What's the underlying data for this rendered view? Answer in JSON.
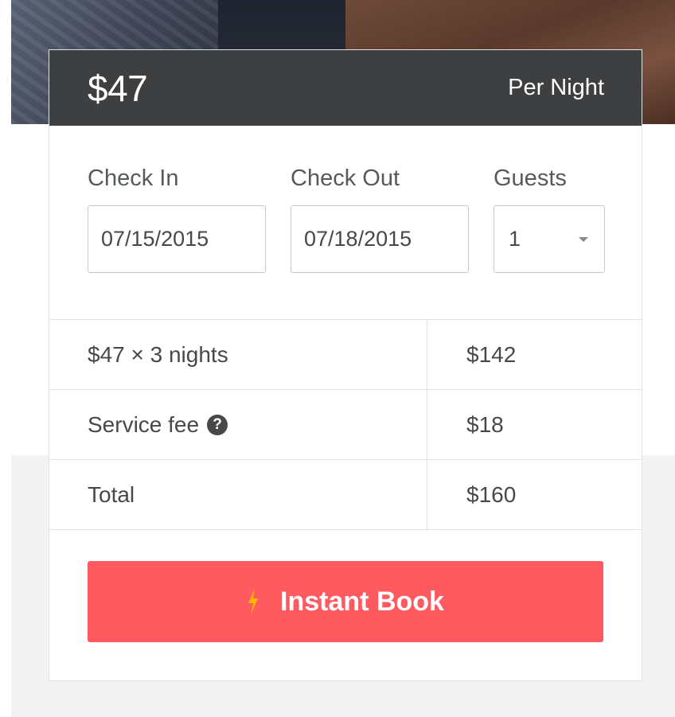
{
  "header": {
    "price": "$47",
    "per_night": "Per Night"
  },
  "booking": {
    "check_in": {
      "label": "Check In",
      "value": "07/15/2015"
    },
    "check_out": {
      "label": "Check Out",
      "value": "07/18/2015"
    },
    "guests": {
      "label": "Guests",
      "value": "1"
    }
  },
  "breakdown": [
    {
      "label": "$47 × 3 nights",
      "amount": "$142"
    },
    {
      "label": "Service fee",
      "amount": "$18",
      "icon": "question-circle-icon"
    },
    {
      "label": "Total",
      "amount": "$160"
    }
  ],
  "cta": {
    "label": "Instant Book",
    "icon": "lightning-bolt-icon",
    "color": "#ff5a5f",
    "icon_color": "#ffb400"
  },
  "colors": {
    "header_bg": "#3d3f41",
    "border": "#e2e2e2",
    "text": "#484848"
  }
}
